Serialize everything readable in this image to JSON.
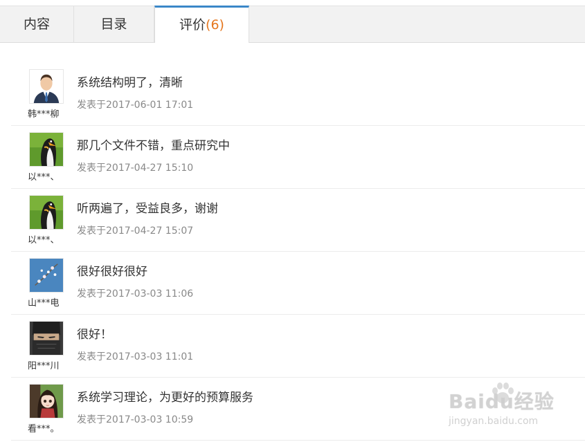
{
  "tabs": [
    {
      "label": "内容"
    },
    {
      "label": "目录"
    },
    {
      "label": "评价",
      "count": "(6)"
    }
  ],
  "comments": [
    {
      "user": "韩***柳",
      "avatar": "businessman-avatar-icon",
      "text": "系统结构明了，清晰",
      "time": "发表于2017-06-01 17:01"
    },
    {
      "user": "以***、",
      "avatar": "penguin-avatar-icon",
      "text": "那几个文件不错，重点研究中",
      "time": "发表于2017-04-27 15:10"
    },
    {
      "user": "以***、",
      "avatar": "penguin-avatar-icon",
      "text": "听两遍了，受益良多，谢谢",
      "time": "发表于2017-04-27 15:07"
    },
    {
      "user": "山***电",
      "avatar": "blossom-avatar-icon",
      "text": "很好很好很好",
      "time": "发表于2017-03-03 11:06"
    },
    {
      "user": "阳***川",
      "avatar": "ninja-avatar-icon",
      "text": "很好！",
      "time": "发表于2017-03-03 11:01"
    },
    {
      "user": "看***。",
      "avatar": "anime-girl-avatar-icon",
      "text": "系统学习理论，为更好的预算服务",
      "time": "发表于2017-03-03 10:59"
    }
  ],
  "watermark": {
    "logo": "Baidu经验",
    "url": "jingyan.baidu.com"
  },
  "colors": {
    "active_tab_border": "#3a87c8",
    "count": "#e5771f",
    "time": "#888888"
  }
}
